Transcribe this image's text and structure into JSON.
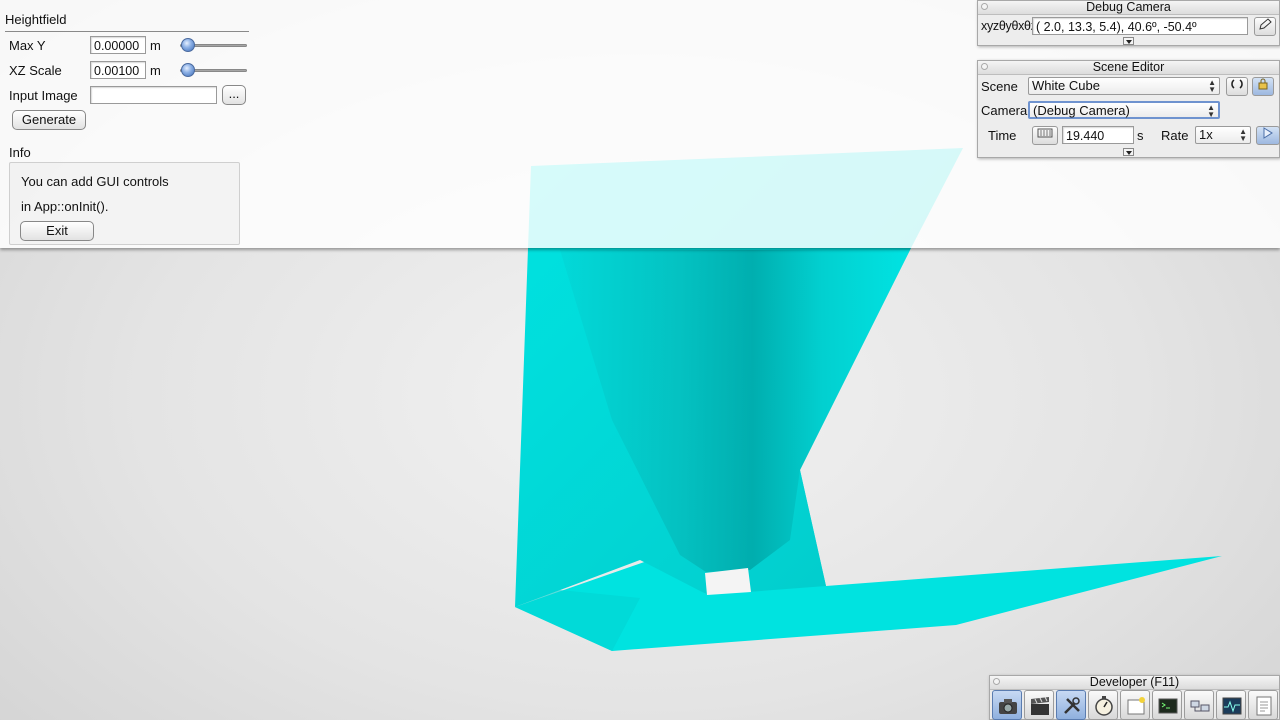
{
  "heightfield": {
    "title": "Heightfield",
    "max_y": {
      "label": "Max Y",
      "value": "0.00000",
      "unit": "m",
      "slider_fraction": 0.0
    },
    "xz_scale": {
      "label": "XZ Scale",
      "value": "0.00100",
      "unit": "m",
      "slider_fraction": 0.0
    },
    "input_image": {
      "label": "Input Image",
      "value": "",
      "browse_label": "..."
    },
    "generate_label": "Generate",
    "info": {
      "title": "Info",
      "line1": "You can add GUI controls",
      "line2": "in App::onInit().",
      "exit_label": "Exit"
    }
  },
  "debug_camera": {
    "title": "Debug Camera",
    "frame_label": "xyzθyθxθz",
    "frame_value": "(  2.0,  13.3,   5.4),  40.6º, -50.4º"
  },
  "scene_editor": {
    "title": "Scene Editor",
    "scene_label": "Scene",
    "scene_value": "White Cube",
    "camera_label": "Camera",
    "camera_value": "(Debug Camera)",
    "time_label": "Time",
    "time_value": "19.440",
    "time_unit": "s",
    "rate_label": "Rate",
    "rate_value": "1x"
  },
  "developer": {
    "title": "Developer (F11)",
    "tools": [
      "camera-icon",
      "clapperboard-icon",
      "wrench-icon",
      "stopwatch-icon",
      "new-window-icon",
      "console-icon",
      "network-icon",
      "graph-icon",
      "document-icon"
    ]
  },
  "colors": {
    "shape": "#00e5e3",
    "shape_dark": "#05b8b8",
    "accent": "#6f93cf"
  }
}
